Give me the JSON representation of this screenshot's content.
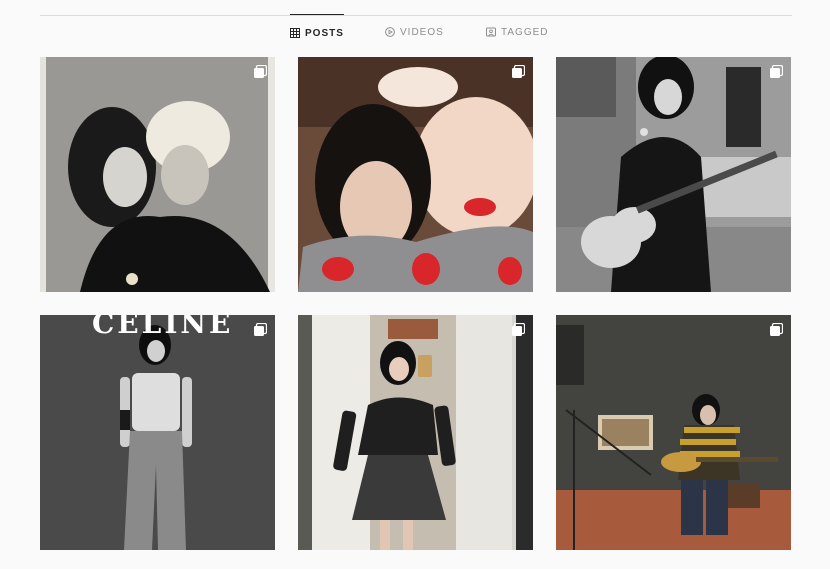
{
  "tabs": [
    {
      "label": "POSTS",
      "icon": "grid-icon",
      "active": true
    },
    {
      "label": "VIDEOS",
      "icon": "play-circle-icon",
      "active": false
    },
    {
      "label": "TAGGED",
      "icon": "tag-user-icon",
      "active": false
    }
  ],
  "posts": [
    {
      "alt_icon": "multiple-photos-icon",
      "scene": "bw-couple-portrait"
    },
    {
      "alt_icon": "multiple-photos-icon",
      "scene": "selfie-red-heart-sweater"
    },
    {
      "alt_icon": "multiple-photos-icon",
      "scene": "bw-guitar-player"
    },
    {
      "alt_icon": "multiple-photos-icon",
      "scene": "bw-celine-studio",
      "brand_text": "CELINE"
    },
    {
      "alt_icon": "multiple-photos-icon",
      "scene": "mirror-selfie-sailor-dress"
    },
    {
      "alt_icon": "multiple-photos-icon",
      "scene": "rehearsal-room-guitar"
    }
  ],
  "colors": {
    "background": "#fafafa",
    "divider": "#dbdbdb",
    "active_tab": "#262626",
    "inactive_tab": "#8e8e8e"
  }
}
